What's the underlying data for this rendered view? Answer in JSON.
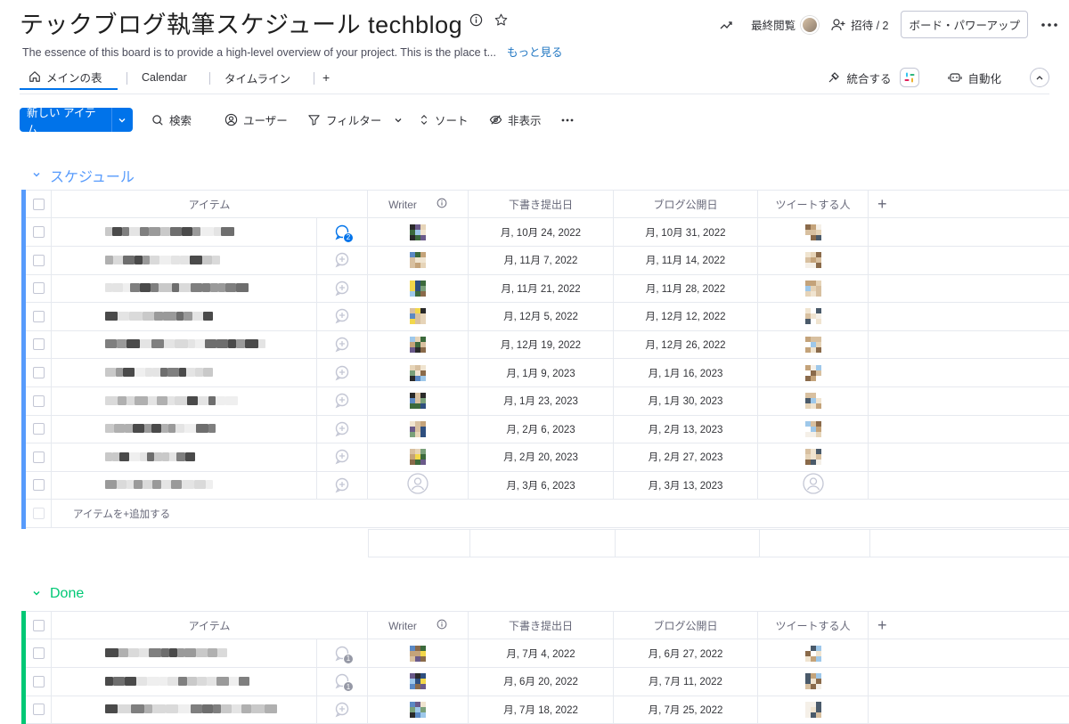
{
  "board": {
    "title": "テックブログ執筆スケジュール techblog",
    "description": "The essence of this board is to provide a high-level overview of your project. This is the place t...",
    "more_link": "もっと見る"
  },
  "header": {
    "recent_viewers": "最終閲覧",
    "invite": "招待 / 2",
    "power_up": "ボード・パワーアップ"
  },
  "tabs": [
    {
      "label": "メインの表",
      "active": true
    },
    {
      "label": "Calendar"
    },
    {
      "label": "タイムライン"
    },
    {
      "label": "+"
    }
  ],
  "tabs_right": {
    "integrate": "統合する",
    "automate": "自動化"
  },
  "toolbar": {
    "new_item": "新しい アイテム",
    "search": "検索",
    "person": "ユーザー",
    "filter": "フィルター",
    "sort": "ソート",
    "hide": "非表示"
  },
  "colors": {
    "accent": "#0073ea",
    "schedule_group": "#579bfc",
    "done_group": "#00c875"
  },
  "columns": {
    "item": "アイテム",
    "writer": "Writer",
    "draft_date": "下書き提出日",
    "publish_date": "ブログ公開日",
    "tweeter": "ツイートする人",
    "add": "+"
  },
  "groups": [
    {
      "name": "スケジュール",
      "color": "#579bfc",
      "add_item": "アイテムを+追加する",
      "rows": [
        {
          "draft": "月, 10月 24, 2022",
          "publish": "月, 10月 31, 2022",
          "updates": 2
        },
        {
          "draft": "月, 11月 7, 2022",
          "publish": "月, 11月 14, 2022"
        },
        {
          "draft": "月, 11月 21, 2022",
          "publish": "月, 11月 28, 2022"
        },
        {
          "draft": "月, 12月 5, 2022",
          "publish": "月, 12月 12, 2022"
        },
        {
          "draft": "月, 12月 19, 2022",
          "publish": "月, 12月 26, 2022"
        },
        {
          "draft": "月, 1月 9, 2023",
          "publish": "月, 1月 16, 2023"
        },
        {
          "draft": "月, 1月 23, 2023",
          "publish": "月, 1月 30, 2023"
        },
        {
          "draft": "月, 2月 6, 2023",
          "publish": "月, 2月 13, 2023"
        },
        {
          "draft": "月, 2月 20, 2023",
          "publish": "月, 2月 27, 2023"
        },
        {
          "draft": "月, 3月 6, 2023",
          "publish": "月, 3月 13, 2023",
          "empty_person": true
        }
      ]
    },
    {
      "name": "Done",
      "color": "#00c875",
      "rows": [
        {
          "draft": "月, 7月 4, 2022",
          "publish": "月, 6月 27, 2022",
          "updates": 1
        },
        {
          "draft": "月, 6月 20, 2022",
          "publish": "月, 7月 11, 2022",
          "updates": 1
        },
        {
          "draft": "月, 7月 18, 2022",
          "publish": "月, 7月 25, 2022"
        }
      ]
    }
  ]
}
